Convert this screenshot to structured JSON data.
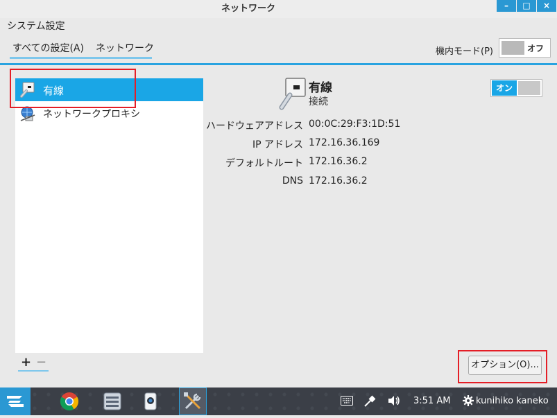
{
  "window": {
    "title": "ネットワーク",
    "minimize_glyph": "–",
    "maximize_glyph": "□",
    "close_glyph": "×"
  },
  "header": {
    "app_title": "システム設定",
    "breadcrumb_all": "すべての設定(A)",
    "breadcrumb_current": "ネットワーク",
    "airplane_mode_label": "機内モード(P)",
    "airplane_mode_state": "オフ"
  },
  "sidebar": {
    "items": [
      {
        "label": "有線",
        "icon": "wired-connection-icon",
        "selected": true
      },
      {
        "label": "ネットワークプロキシ",
        "icon": "network-proxy-icon",
        "selected": false
      }
    ],
    "add_label": "+",
    "remove_label": "−"
  },
  "detail": {
    "name": "有線",
    "status": "接続",
    "power_state": "オン",
    "fields": [
      {
        "label": "ハードウェアアドレス",
        "value": "00:0C:29:F3:1D:51"
      },
      {
        "label": "IP アドレス",
        "value": "172.16.36.169"
      },
      {
        "label": "デフォルトルート",
        "value": "172.16.36.2"
      },
      {
        "label": "DNS",
        "value": "172.16.36.2"
      }
    ],
    "options_button": "オプション(O)..."
  },
  "taskbar": {
    "apps": [
      "chrome-icon",
      "file-manager-icon",
      "camera-icon",
      "settings-tools-icon"
    ],
    "tray_icons": [
      "keyboard-icon",
      "network-icon",
      "volume-icon"
    ],
    "clock": "3:51 AM",
    "user": "kunihiko kaneko"
  },
  "colors": {
    "accent": "#1aa6e6",
    "annotation_red": "#e41e26",
    "taskbar": "#3b3f47"
  }
}
